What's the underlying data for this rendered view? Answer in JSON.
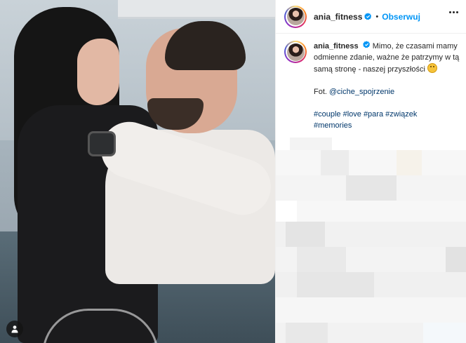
{
  "post": {
    "username": "ania_fitness",
    "separator": "•",
    "follow_label": "Obserwuj"
  },
  "caption": {
    "username": "ania_fitness",
    "text": "Mimo, że czasami mamy odmienne zdanie, ważne że patrzymy w tą samą stronę - naszej przyszłości",
    "photo_credit_prefix": "Fot.",
    "photo_credit_user": "@ciche_spojrzenie",
    "hashtags_line1": "#couple #love #para #związek",
    "hashtags_line2": "#memories"
  },
  "colors": {
    "accent": "#0095f6",
    "link": "#00376b",
    "text": "#262626",
    "border": "#efefef"
  },
  "icons": [
    "verified-badge-icon",
    "more-options-icon",
    "user-tag-icon",
    "smiley-emoji-icon"
  ]
}
